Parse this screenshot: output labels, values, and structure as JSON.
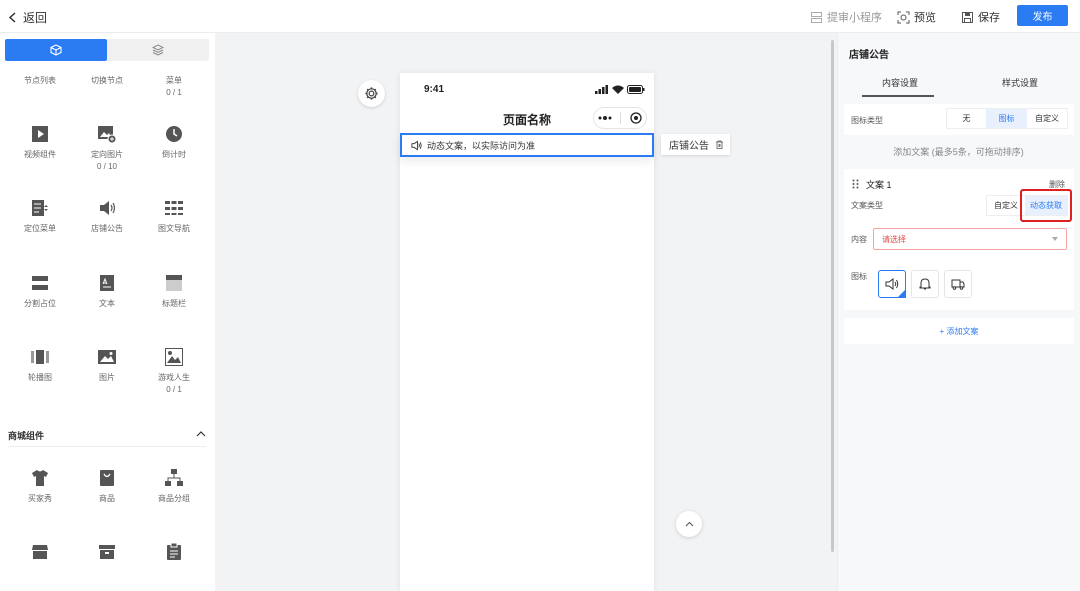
{
  "topbar": {
    "back_label": "返回",
    "submit_label": "提审小程序",
    "preview_label": "预览",
    "save_label": "保存",
    "publish_label": "发布"
  },
  "left": {
    "row0": [
      {
        "label": "节点列表",
        "count": ""
      },
      {
        "label": "切换节点",
        "count": ""
      },
      {
        "label": "菜单",
        "count": "0 / 1"
      }
    ],
    "components": [
      {
        "label": "视频组件",
        "count": "",
        "icon": "video-icon"
      },
      {
        "label": "定向图片",
        "count": "0 / 10",
        "icon": "image-add-icon"
      },
      {
        "label": "倒计时",
        "count": "",
        "icon": "clock-icon"
      },
      {
        "label": "定位菜单",
        "count": "",
        "icon": "locate-menu-icon"
      },
      {
        "label": "店铺公告",
        "count": "",
        "icon": "speaker-icon"
      },
      {
        "label": "图文导航",
        "count": "",
        "icon": "grid-nav-icon"
      },
      {
        "label": "分割占位",
        "count": "",
        "icon": "divider-icon"
      },
      {
        "label": "文本",
        "count": "",
        "icon": "text-icon"
      },
      {
        "label": "标题栏",
        "count": "",
        "icon": "title-bar-icon"
      },
      {
        "label": "轮播图",
        "count": "",
        "icon": "carousel-icon"
      },
      {
        "label": "图片",
        "count": "",
        "icon": "picture-icon"
      },
      {
        "label": "游戏人生",
        "count": "0 / 1",
        "icon": "game-icon"
      }
    ],
    "section_title": "商城组件",
    "mall": [
      {
        "label": "买家秀",
        "icon": "tshirt-icon"
      },
      {
        "label": "商品",
        "icon": "bag-icon"
      },
      {
        "label": "商品分组",
        "icon": "hierarchy-icon"
      }
    ]
  },
  "phone": {
    "time": "9:41",
    "page_title": "页面名称",
    "notice_text": "动态文案，以实际访问为准",
    "tag_label": "店铺公告"
  },
  "right": {
    "title": "店铺公告",
    "tab_content": "内容设置",
    "tab_style": "样式设置",
    "icon_type_label": "图标类型",
    "icon_type_options": [
      "无",
      "图标",
      "自定义"
    ],
    "icon_type_selected": "图标",
    "hint": "添加文案 (最多5条，可拖动排序)",
    "copy_title": "文案 1",
    "delete_label": "删除",
    "copy_type_label": "文案类型",
    "copy_type_options": [
      "自定义",
      "动态获取"
    ],
    "copy_type_selected": "动态获取",
    "content_label": "内容",
    "content_placeholder": "请选择",
    "icon_label": "图标",
    "add_copy_label": "+ 添加文案"
  },
  "colors": {
    "accent": "#2b7bf3",
    "highlight_red": "#e02020"
  }
}
